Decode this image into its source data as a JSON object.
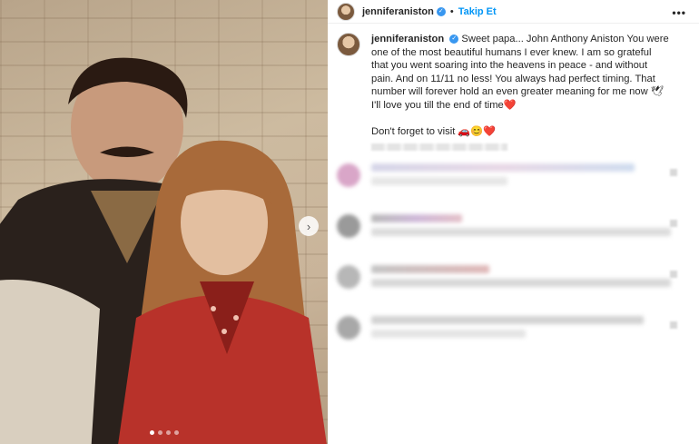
{
  "header": {
    "username": "jenniferaniston",
    "separator": "•",
    "follow_label": "Takip Et",
    "more_label": "•••"
  },
  "caption": {
    "username": "jenniferaniston",
    "text_main": "Sweet papa... John Anthony Aniston You were one of the most beautiful humans I ever knew. I am so grateful that you went soaring into the heavens in peace - and without pain. And on 11/11 no less! You always had perfect timing. That number will forever hold an even greater meaning for me now 🕊I'll love you till the end of time❤️",
    "text_visit": "Don't forget to visit 🚗😊❤️"
  },
  "carousel": {
    "next_label": "›",
    "dots": 4,
    "active_dot": 1
  },
  "colors": {
    "follow": "#0095f6",
    "verified": "#3897f0"
  }
}
